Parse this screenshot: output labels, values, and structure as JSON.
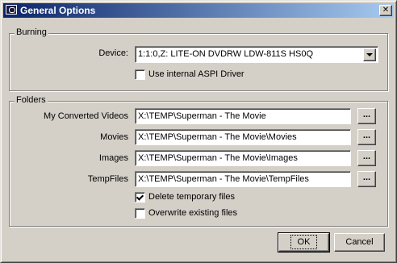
{
  "window": {
    "title": "General Options",
    "close_label": "✕"
  },
  "burning": {
    "group_label": "Burning",
    "device_label": "Device:",
    "device_value": "1:1:0,Z: LITE-ON DVDRW LDW-811S  HS0Q",
    "aspi_label": "Use internal ASPI Driver",
    "aspi_checked": false
  },
  "folders": {
    "group_label": "Folders",
    "rows": [
      {
        "label": "My Converted Videos",
        "value": "X:\\TEMP\\Superman - The Movie"
      },
      {
        "label": "Movies",
        "value": "X:\\TEMP\\Superman - The Movie\\Movies"
      },
      {
        "label": "Images",
        "value": "X:\\TEMP\\Superman - The Movie\\Images"
      },
      {
        "label": "TempFiles",
        "value": "X:\\TEMP\\Superman - The Movie\\TempFiles"
      }
    ],
    "browse_label": "...",
    "delete_temp_label": "Delete temporary files",
    "delete_temp_checked": true,
    "overwrite_label": "Overwrite existing files",
    "overwrite_checked": false
  },
  "buttons": {
    "ok": "OK",
    "cancel": "Cancel"
  }
}
